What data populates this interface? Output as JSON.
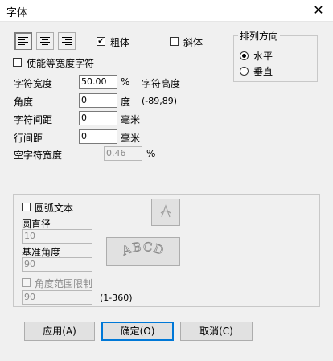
{
  "window": {
    "title": "字体",
    "close_glyph": "✕"
  },
  "style": {
    "bold_label": "粗体",
    "bold_checked": true,
    "italic_label": "斜体",
    "italic_checked": false
  },
  "equal_width": {
    "label": "使能等宽度字符",
    "checked": false
  },
  "direction": {
    "title": "排列方向",
    "options": [
      "水平",
      "垂直"
    ],
    "selected": "水平"
  },
  "fields": {
    "width_ratio": {
      "label": "字符宽度",
      "value": "50.00",
      "unit": "%"
    },
    "char_height": {
      "label": "字符高度"
    },
    "angle": {
      "label": "角度",
      "value": "0",
      "unit": "度",
      "range": "(-89,89)"
    },
    "char_spacing": {
      "label": "字符间距",
      "value": "0",
      "unit": "毫米"
    },
    "line_spacing": {
      "label": "行间距",
      "value": "0",
      "unit": "毫米"
    },
    "space_width": {
      "label": "空字符宽度",
      "value": "0.46",
      "unit": "%"
    }
  },
  "arc": {
    "label": "圆弧文本",
    "checked": false,
    "diameter_label": "圆直径",
    "diameter_value": "10",
    "base_angle_label": "基准角度",
    "base_angle_value": "90",
    "limit_label": "角度范围限制",
    "limit_value": "90",
    "limit_range": "(1-360)",
    "preview_text": "ABCD"
  },
  "buttons": {
    "apply": "应用(A)",
    "ok": "确定(O)",
    "cancel": "取消(C)"
  }
}
